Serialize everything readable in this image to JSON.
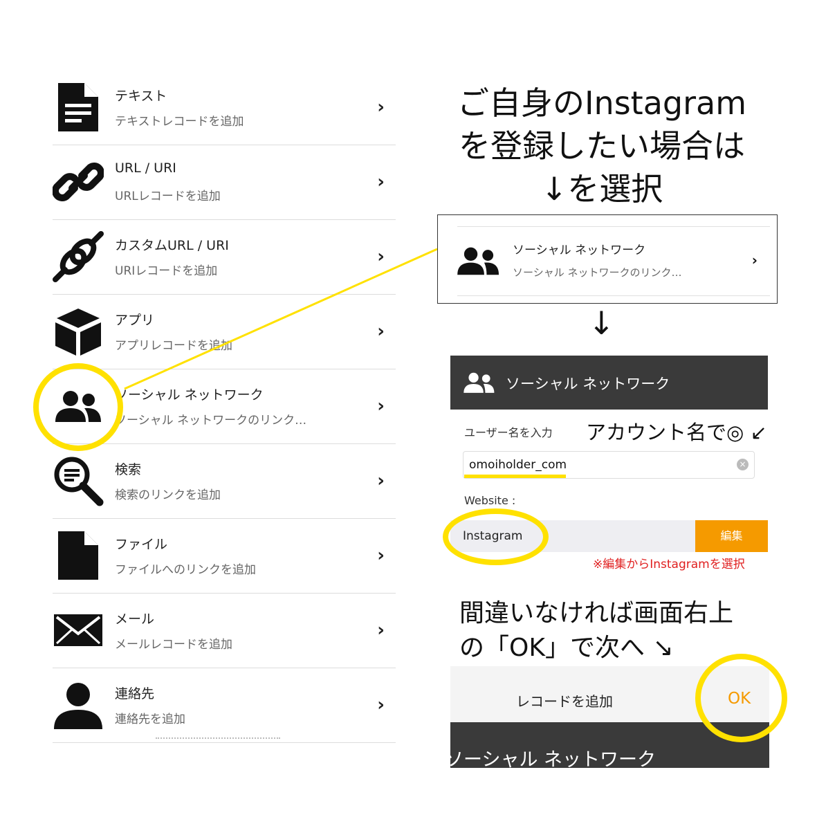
{
  "list": [
    {
      "id": "text",
      "icon": "document-icon",
      "title": "テキスト",
      "subtitle": "テキストレコードを追加"
    },
    {
      "id": "url",
      "icon": "link-icon",
      "title": "URL / URI",
      "subtitle": "URLレコードを追加"
    },
    {
      "id": "custom-url",
      "icon": "custom-link-icon",
      "title": "カスタムURL / URI",
      "subtitle": "URIレコードを追加"
    },
    {
      "id": "app",
      "icon": "cube-icon",
      "title": "アプリ",
      "subtitle": "アプリレコードを追加"
    },
    {
      "id": "social",
      "icon": "people-icon",
      "title": "ソーシャル ネットワーク",
      "subtitle": "ソーシャル ネットワークのリンク…"
    },
    {
      "id": "search",
      "icon": "search-icon",
      "title": "検索",
      "subtitle": "検索のリンクを追加"
    },
    {
      "id": "file",
      "icon": "file-icon",
      "title": "ファイル",
      "subtitle": "ファイルへのリンクを追加"
    },
    {
      "id": "mail",
      "icon": "mail-icon",
      "title": "メール",
      "subtitle": "メールレコードを追加"
    },
    {
      "id": "contact",
      "icon": "person-icon",
      "title": "連絡先",
      "subtitle": "連絡先を追加"
    }
  ],
  "chevron": "›",
  "heading": {
    "line1": "ご自身のInstagram",
    "line2": "を登録したい場合は",
    "line3": "↓を選択"
  },
  "card": {
    "title": "ソーシャル ネットワーク",
    "subtitle": "ソーシャル ネットワークのリンク…"
  },
  "down_arrow": "↓",
  "form": {
    "header_title": "ソーシャル ネットワーク",
    "username_label": "ユーザー名を入力",
    "username_hint": "アカウント名で◎ ↙",
    "username_value": "omoiholder_com",
    "clear_icon": "×",
    "website_label": "Website :",
    "website_value": "Instagram",
    "edit_button": "編集",
    "note": "※編集からInstagramを選択"
  },
  "confirm": {
    "line1": "間違いなければ画面右上",
    "line2": "の「OK」で次へ ↘"
  },
  "okbar": {
    "title": "レコードを追加",
    "ok_button": "OK"
  },
  "darkbar_title": "ソーシャル ネットワーク",
  "colors": {
    "highlight": "#ffe100",
    "accent": "#f59a00",
    "dark_bar": "#3a3a3a",
    "note": "#e02020"
  }
}
